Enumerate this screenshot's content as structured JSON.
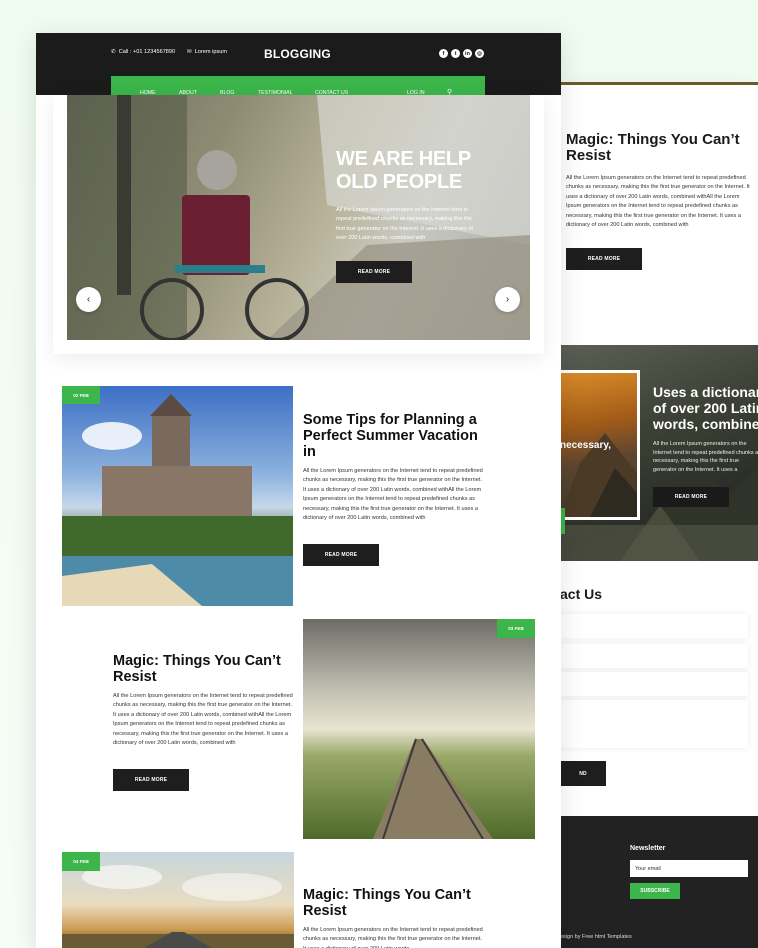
{
  "colors": {
    "accent": "#3cb54a",
    "dark": "#1b1b1b",
    "page_bg": "#f2fbf2"
  },
  "topbar": {
    "call": "Call : +01 1234567890",
    "email": "Lorem ipsum",
    "logo": "BLOGGING",
    "social": [
      "facebook-icon",
      "twitter-icon",
      "linkedin-icon",
      "instagram-icon"
    ]
  },
  "nav": {
    "items": [
      "HOME",
      "ABOUT",
      "BLOG",
      "TESTIMONIAL",
      "CONTACT US"
    ],
    "login": "LOG IN"
  },
  "hero": {
    "title_line1": "WE ARE HELP",
    "title_line2": "OLD PEOPLE",
    "text": "All the Lorem Ipsum generators on the Internet tend to repeat predefined chunks as necessary, making this the first true generator on the Internet. It uses a dictionary of over 200 Latin words, combined with",
    "button": "READ MORE"
  },
  "posts": [
    {
      "date": "02 FEB",
      "title": "Some Tips for Planning a Perfect Summer Vacation in",
      "text": "All the Lorem Ipsum generators on the Internet tend to repeat predefined chunks as necessary, making this the first true generator on the Internet. It uses a dictionary of over 200 Latin words, combined withAll the Lorem Ipsum generators on the Internet tend to repeat predefined chunks as necessary, making this the first true generator on the Internet. It uses a dictionary of over 200 Latin words, combined with",
      "button": "READ MORE"
    },
    {
      "date": "03 FEB",
      "title": "Magic: Things You Can’t Resist",
      "text": "All the Lorem Ipsum generators on the Internet tend to repeat predefined chunks as necessary, making this the first true generator on the Internet. It uses a dictionary of over 200 Latin words, combined withAll the Lorem Ipsum generators on the Internet tend to repeat predefined chunks as necessary, making this the first true generator on the Internet. It uses a dictionary of over 200 Latin words, combined with",
      "button": "READ MORE"
    },
    {
      "date": "04 FEB",
      "title": "Magic: Things You Can’t Resist",
      "text": "All the Lorem Ipsum generators on the Internet tend to repeat predefined chunks as necessary, making this the first true generator on the Internet. It uses a dictionary of over 200 Latin words"
    }
  ],
  "back": {
    "title": "Magic: Things You Can’t Resist",
    "text": "All the Lorem Ipsum generators on the Internet tend to repeat predefined chunks as necessary, making this the first true generator on the Internet. It uses a dictionary of over 200 Latin words, combined withAll the Lorem Ipsum generators on the Internet tend to repeat predefined chunks as necessary, making this the first true generator on the Internet. It uses a dictionary of over 200 Latin words, combined with",
    "button": "READ MORE",
    "slide_title": "Uses a dictionary of over 200 Latin words, combined",
    "slide_text": "All the Lorem Ipsum generators on the Internet tend to repeat predefined chunks as necessary, making this the first true generator on the Internet. It uses a",
    "slide_button": "READ MORE",
    "frame_text": "necessary,",
    "contact_title": "act Us",
    "send": "ND",
    "newsletter": "Newsletter",
    "email_placeholder": "Your email",
    "subscribe": "SUBSCRIBE",
    "copyright": "esign by Free html Templates"
  }
}
